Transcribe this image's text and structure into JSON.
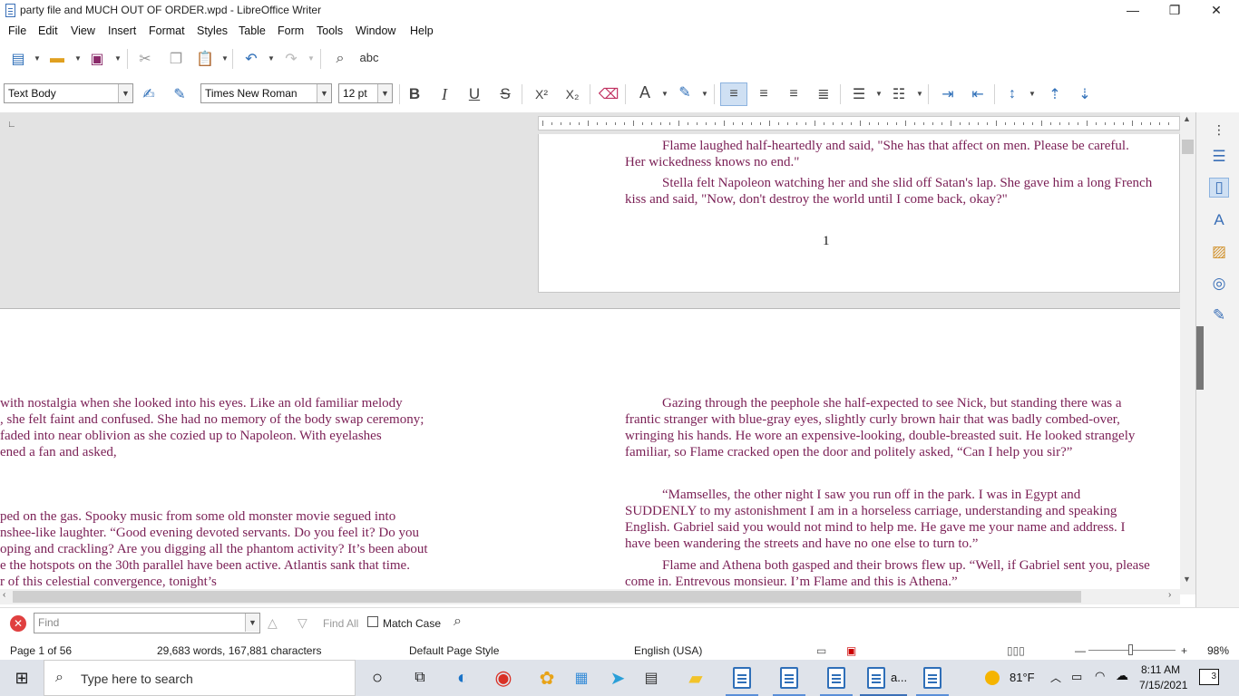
{
  "window": {
    "title": "party file and MUCH OUT OF ORDER.wpd - LibreOffice Writer",
    "minimize": "—",
    "restore": "❐",
    "close": "✕"
  },
  "menu": [
    "File",
    "Edit",
    "View",
    "Insert",
    "Format",
    "Styles",
    "Table",
    "Form",
    "Tools",
    "Window",
    "Help"
  ],
  "formatting": {
    "paragraph_style": "Text Body",
    "font_name": "Times New Roman",
    "font_size": "12 pt",
    "spelling_label": "abc",
    "bold": "B",
    "italic": "I",
    "underline": "U",
    "strikethrough": "S",
    "superscript": "X²",
    "subscript": "X₂",
    "font_color_letter": "A",
    "font_color": "#c00000",
    "highlight_color": "#ffff00"
  },
  "page1": {
    "lines": [
      "Flame laughed half-heartedly and said, \"She has that affect on men.  Please be careful.",
      "Her wickedness knows no end.\"",
      "Stella felt Napoleon watching her and she slid off Satan's lap.  She gave him a long French",
      "kiss and said,  \"Now, don't destroy the world until I come back, okay?\""
    ],
    "page_number": "1"
  },
  "left_column": {
    "para1": [
      "with nostalgia when she looked into his eyes. Like an old familiar melody",
      ", she felt faint and confused. She had no memory of the body swap ceremony;",
      "faded into near oblivion as she cozied up to Napoleon. With eyelashes",
      "ened a fan and asked,"
    ],
    "para2": [
      "ped on the gas.  Spooky music from some old monster movie segued into",
      "nshee-like laughter.  “Good evening devoted servants.  Do you feel it?  Do you",
      "oping and crackling?  Are you digging all the phantom activity?  It’s been about",
      "e the hotspots on the 30th parallel have been active.  Atlantis sank that time.",
      "r of this celestial convergence, tonight’s"
    ]
  },
  "right_column": {
    "para1": [
      "Gazing through the peephole she half-expected to see Nick, but standing there was a",
      "frantic stranger with blue-gray eyes, slightly curly brown hair that was badly combed-over,",
      "wringing his hands.  He wore an expensive-looking, double-breasted suit.  He looked strangely",
      "familiar, so Flame cracked open the door and politely asked, “Can I help you sir?”"
    ],
    "para2": [
      "“Mamselles, the other night I saw you run off in the park.  I was in Egypt and",
      "SUDDENLY to my astonishment I am in a horseless carriage, understanding and speaking",
      "English. Gabriel said you would not mind to help me.  He gave me your name and address.  I",
      "have been wandering the streets and have no one else to turn to.”"
    ],
    "para3": [
      "Flame and Athena both gasped and their brows flew up.  “Well, if Gabriel sent you, please",
      "come in.  Entrevous monsieur.  I’m Flame and this is Athena.”"
    ]
  },
  "findbar": {
    "placeholder": "Find",
    "find_all": "Find All",
    "match_case": "Match Case"
  },
  "statusbar": {
    "page": "Page 1 of 56",
    "words": "29,683 words, 167,881 characters",
    "page_style": "Default Page Style",
    "language": "English (USA)",
    "zoom": "98%"
  },
  "taskbar": {
    "search_placeholder": "Type here to search",
    "weather": "81°F",
    "time": "8:11 AM",
    "date": "7/15/2021",
    "notifications": "3",
    "app_label": "a..."
  }
}
